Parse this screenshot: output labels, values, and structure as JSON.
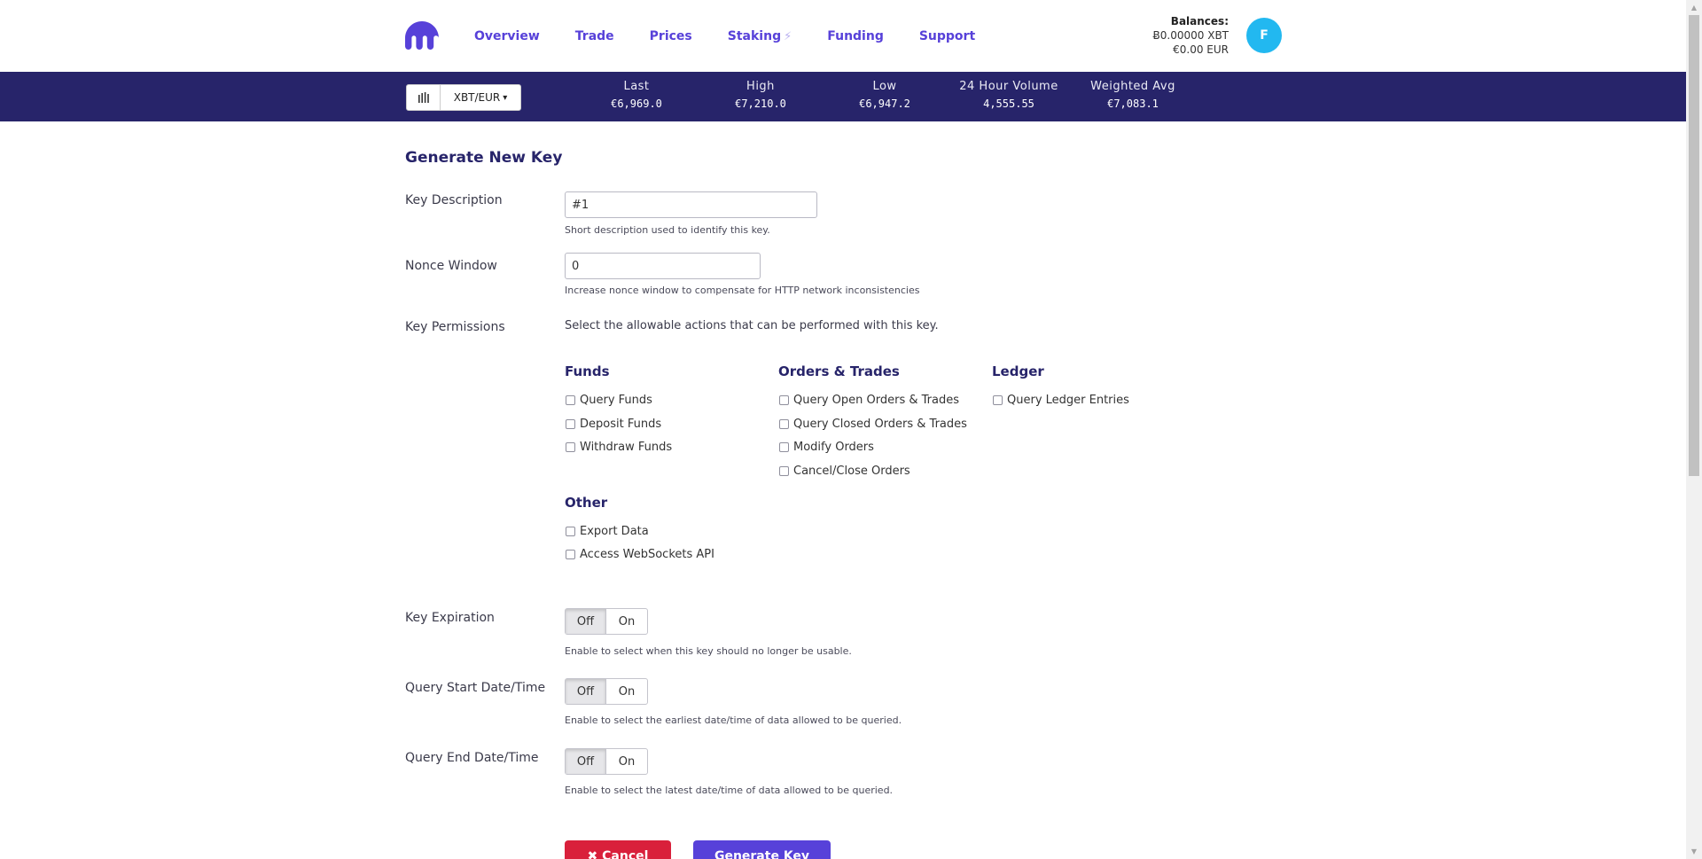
{
  "nav": {
    "links": [
      {
        "label": "Overview"
      },
      {
        "label": "Trade"
      },
      {
        "label": "Prices"
      },
      {
        "label": "Staking",
        "has_bolt": true
      },
      {
        "label": "Funding"
      },
      {
        "label": "Support"
      }
    ],
    "bolt_icon": "⚡"
  },
  "balances": {
    "title": "Balances:",
    "xbt": "Ƀ0.00000 XBT",
    "eur": "€0.00 EUR"
  },
  "avatar": {
    "initial": "F",
    "color": "#22b8f0"
  },
  "ticker": {
    "pair": "XBT/EUR",
    "caret": "▾",
    "stats": [
      {
        "label": "Last",
        "value": "€6,969.0"
      },
      {
        "label": "High",
        "value": "€7,210.0"
      },
      {
        "label": "Low",
        "value": "€6,947.2"
      },
      {
        "label": "24 Hour Volume",
        "value": "4,555.55"
      },
      {
        "label": "Weighted Avg",
        "value": "€7,083.1"
      }
    ]
  },
  "form": {
    "title": "Generate New Key",
    "key_description": {
      "label": "Key Description",
      "value": "#1",
      "help": "Short description used to identify this key."
    },
    "nonce_window": {
      "label": "Nonce Window",
      "value": "0",
      "help": "Increase nonce window to compensate for HTTP network inconsistencies"
    },
    "key_permissions": {
      "label": "Key Permissions",
      "intro": "Select the allowable actions that can be performed with this key.",
      "groups": {
        "funds": {
          "title": "Funds",
          "items": [
            "Query Funds",
            "Deposit Funds",
            "Withdraw Funds"
          ]
        },
        "orders": {
          "title": "Orders & Trades",
          "items": [
            "Query Open Orders & Trades",
            "Query Closed Orders & Trades",
            "Modify Orders",
            "Cancel/Close Orders"
          ]
        },
        "ledger": {
          "title": "Ledger",
          "items": [
            "Query Ledger Entries"
          ]
        },
        "other": {
          "title": "Other",
          "items": [
            "Export Data",
            "Access WebSockets API"
          ]
        }
      }
    },
    "key_expiration": {
      "label": "Key Expiration",
      "off": "Off",
      "on": "On",
      "help": "Enable to select when this key should no longer be usable."
    },
    "query_start": {
      "label": "Query Start Date/Time",
      "off": "Off",
      "on": "On",
      "help": "Enable to select the earliest date/time of data allowed to be queried."
    },
    "query_end": {
      "label": "Query End Date/Time",
      "off": "Off",
      "on": "On",
      "help": "Enable to select the latest date/time of data allowed to be queried."
    },
    "buttons": {
      "cancel": "✖ Cancel",
      "generate": "Generate Key"
    }
  },
  "colors": {
    "brand": "#5741d9",
    "ticker_bg": "#27246a",
    "cancel": "#d9203b"
  }
}
